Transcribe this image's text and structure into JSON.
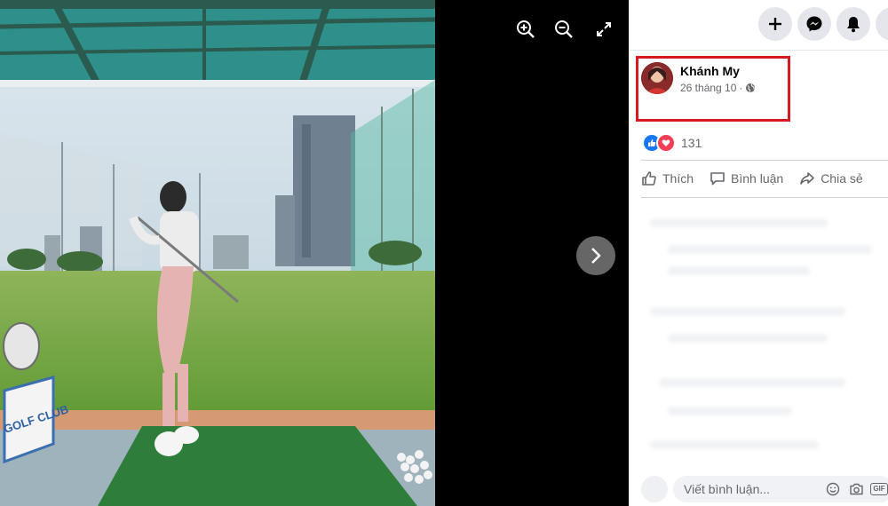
{
  "viewer": {
    "zoom_in_icon": "zoom-in-icon",
    "zoom_out_icon": "zoom-out-icon",
    "fullscreen_icon": "expand-icon",
    "next_icon": "chevron-right-icon",
    "photo_sign_text": "GOLF CLUB"
  },
  "topbar": {
    "buttons": [
      "plus-icon",
      "messenger-icon",
      "bell-icon"
    ]
  },
  "post": {
    "author": "Khánh My",
    "date": "26 tháng 10",
    "separator": "·",
    "privacy_icon": "globe-icon",
    "reaction_count": "131",
    "reactions": [
      "like",
      "love"
    ]
  },
  "actions": {
    "like": "Thích",
    "comment": "Bình luận",
    "share": "Chia sẻ"
  },
  "comment_box": {
    "placeholder": "Viết bình luận...",
    "icons": [
      "emoji-icon",
      "camera-icon",
      "gif-icon"
    ],
    "gif_label": "GIF"
  },
  "colors": {
    "highlight": "#d71920",
    "like_blue": "#1877f2",
    "love_red": "#f33e58"
  }
}
